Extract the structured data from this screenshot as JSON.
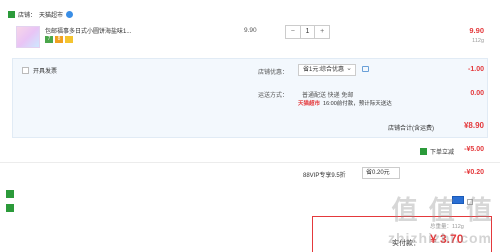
{
  "store": {
    "label": "店铺：",
    "name": "天猫超市"
  },
  "item": {
    "title": "包邮福事多日式小圆饼海盐味1...",
    "unit_price": "9.90",
    "quantity": "1",
    "minus": "−",
    "plus": "+",
    "subtotal": "9.90",
    "weight": "112g",
    "badges": [
      "7",
      "8",
      ""
    ]
  },
  "invoice": {
    "label": "开具发票"
  },
  "discount": {
    "label": "店铺优惠：",
    "selected": "省1元:综合优惠",
    "amount": "-1.00"
  },
  "shipping": {
    "label": "运送方式：",
    "methods": "普通配送 快递 免邮",
    "tmall_logo": "天猫超市",
    "note": "16:00前付款，预计际天送达",
    "amount": "0.00"
  },
  "store_total": {
    "label": "店铺合计(含运费)",
    "amount": "¥8.90"
  },
  "instant": {
    "label": "下单立减",
    "amount": "-¥5.00"
  },
  "vip": {
    "label": "88VIP专享9.5折",
    "selected": "省0.20元",
    "amount": "-¥0.20"
  },
  "footer": {
    "weight": "总重量：112g",
    "total_label": "实付款：",
    "total_amount": "¥ 3.70"
  },
  "watermark": {
    "text": "值 值 值",
    "site": "zhizhizhi.com"
  },
  "colors": {
    "accent": "#e4393c",
    "brand_green": "#2b9a3a",
    "panel_bg": "#f3f8fd"
  }
}
